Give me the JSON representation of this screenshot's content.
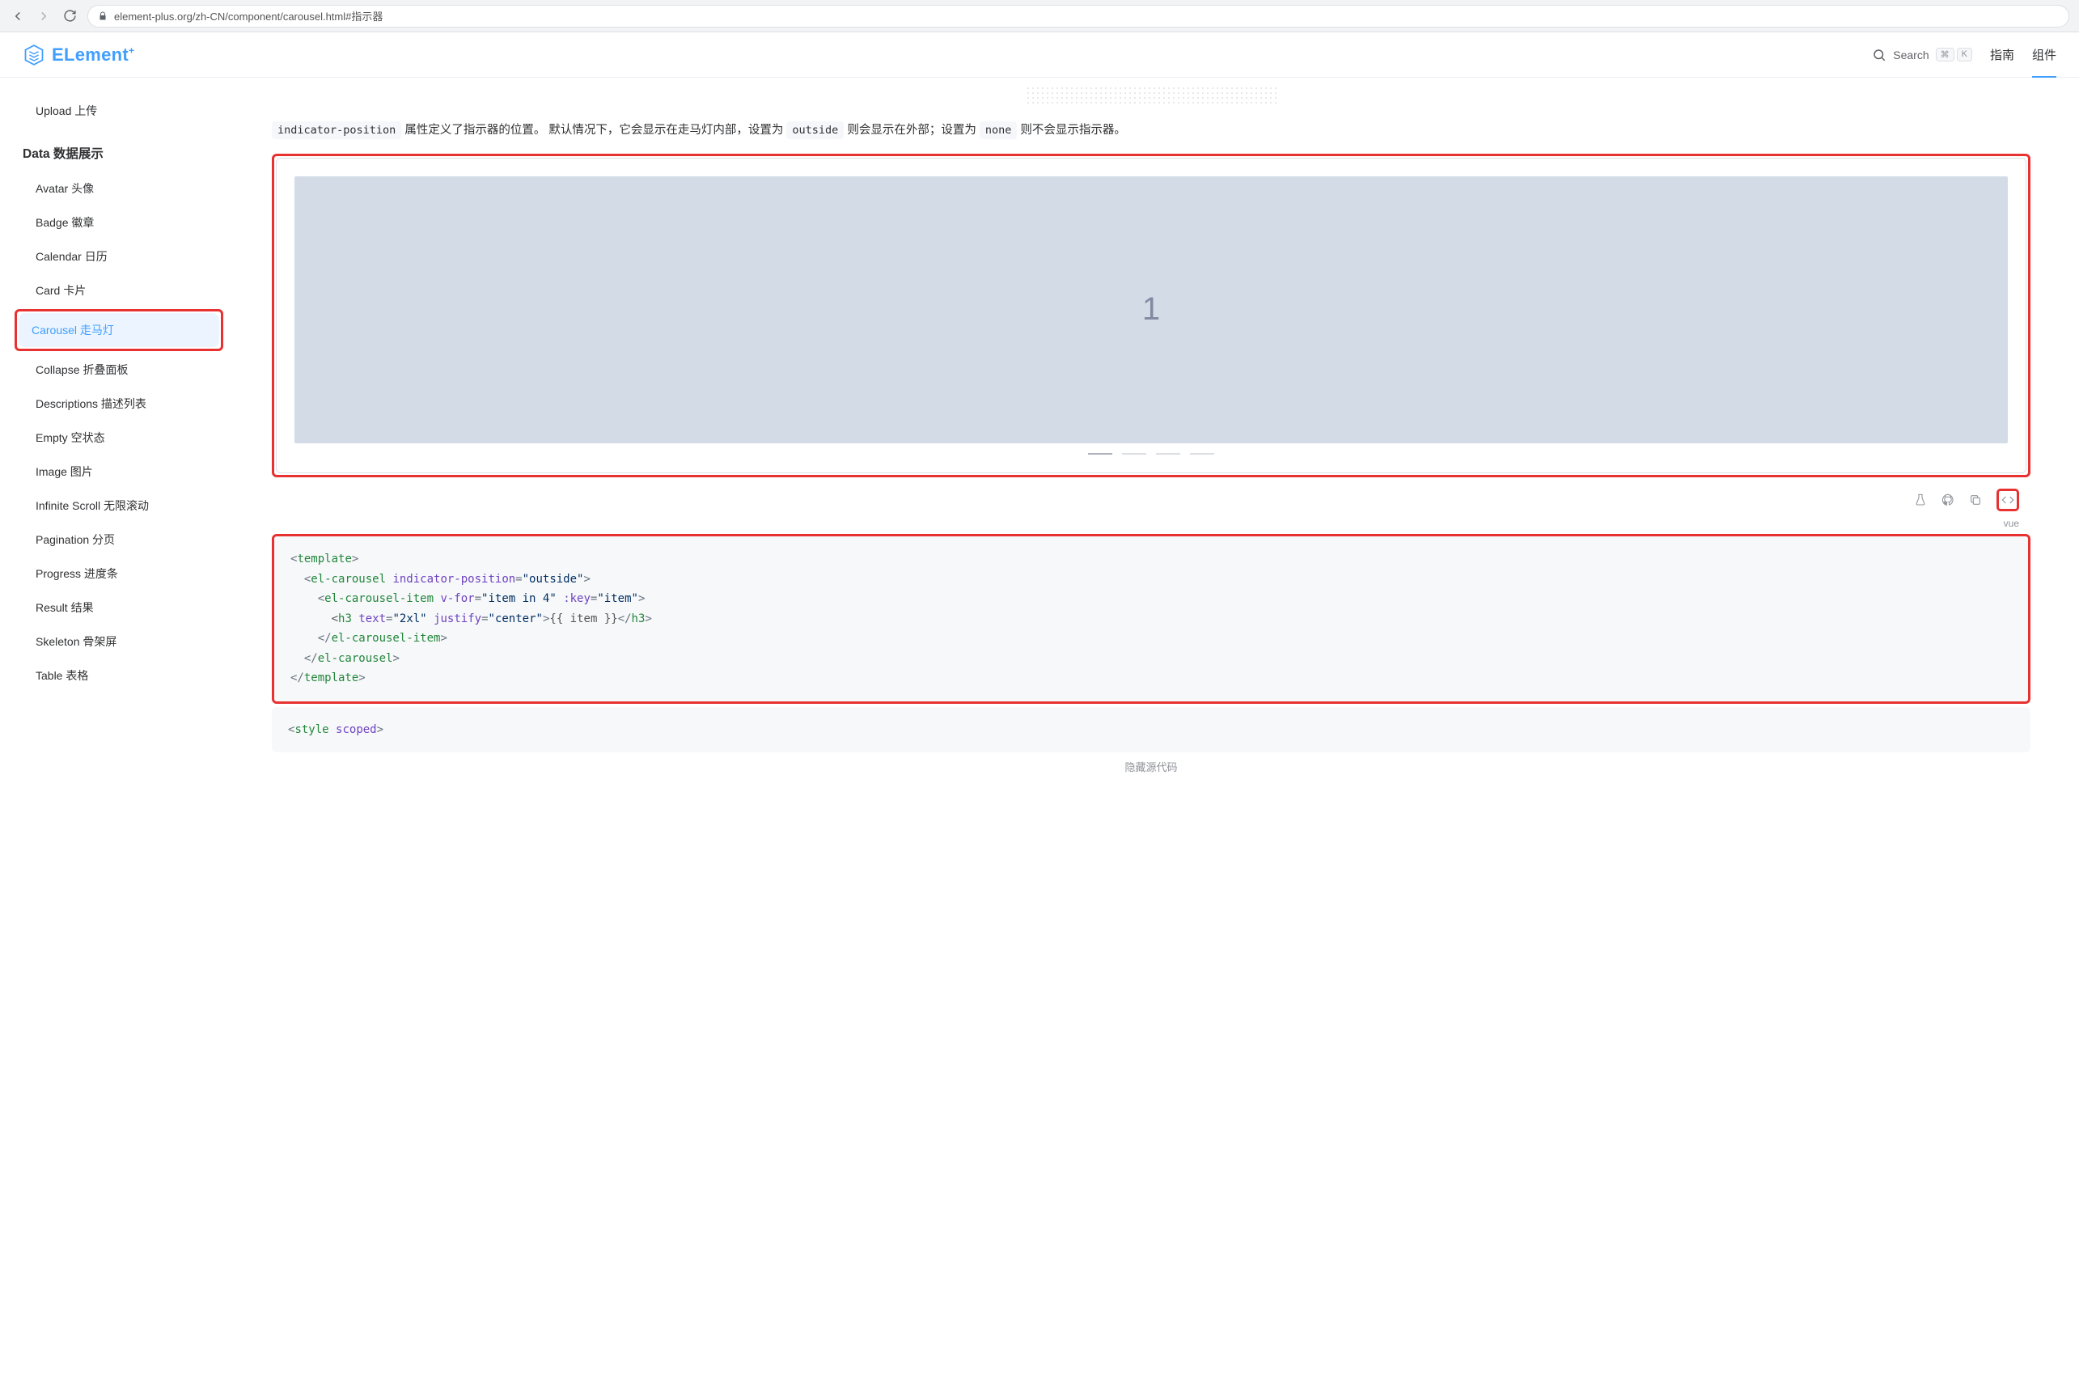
{
  "browser": {
    "url": "element-plus.org/zh-CN/component/carousel.html#指示器"
  },
  "header": {
    "logo_text": "ELement",
    "logo_sup": "+",
    "search_label": "Search",
    "shortcut1": "⌘",
    "shortcut2": "K",
    "nav": {
      "guide": "指南",
      "component": "组件"
    }
  },
  "sidebar": {
    "upload": "Upload 上传",
    "section_data": "Data 数据展示",
    "items": {
      "avatar": "Avatar 头像",
      "badge": "Badge 徽章",
      "calendar": "Calendar 日历",
      "card": "Card 卡片",
      "carousel": "Carousel 走马灯",
      "collapse": "Collapse 折叠面板",
      "descriptions": "Descriptions 描述列表",
      "empty": "Empty 空状态",
      "image": "Image 图片",
      "infinite": "Infinite Scroll 无限滚动",
      "pagination": "Pagination 分页",
      "progress": "Progress 进度条",
      "result": "Result 结果",
      "skeleton": "Skeleton 骨架屏",
      "table": "Table 表格"
    }
  },
  "desc": {
    "code_indicator": "indicator-position",
    "part1": " 属性定义了指示器的位置。 默认情况下，它会显示在走马灯内部，设置为 ",
    "code_outside": "outside",
    "part2": " 则会显示在外部；设置为 ",
    "code_none": "none",
    "part3": " 则不会显示指示器。"
  },
  "demo": {
    "slide_num": "1",
    "lang": "vue"
  },
  "code": {
    "l1_open": "<",
    "l1_tag": "template",
    "l1_close": ">",
    "l2_open": "<",
    "l2_tag": "el-carousel",
    "l2_sp": " ",
    "l2_attr": "indicator-position",
    "l2_eq": "=",
    "l2_val": "\"outside\"",
    "l2_close": ">",
    "l3_open": "<",
    "l3_tag": "el-carousel-item",
    "l3_sp1": " ",
    "l3_attr1": "v-for",
    "l3_eq1": "=",
    "l3_val1": "\"item in 4\"",
    "l3_sp2": " ",
    "l3_attr2": ":key",
    "l3_eq2": "=",
    "l3_val2": "\"item\"",
    "l3_close": ">",
    "l4_open": "<",
    "l4_tag": "h3",
    "l4_sp1": " ",
    "l4_attr1": "text",
    "l4_eq1": "=",
    "l4_val1": "\"2xl\"",
    "l4_sp2": " ",
    "l4_attr2": "justify",
    "l4_eq2": "=",
    "l4_val2": "\"center\"",
    "l4_close": ">",
    "l4_inner": "{{ item }}",
    "l4_cls_open": "</",
    "l4_cls_tag": "h3",
    "l4_cls_close": ">",
    "l5_open": "</",
    "l5_tag": "el-carousel-item",
    "l5_close": ">",
    "l6_open": "</",
    "l6_tag": "el-carousel",
    "l6_close": ">",
    "l7_open": "</",
    "l7_tag": "template",
    "l7_close": ">",
    "style_open": "<",
    "style_tag": "style",
    "style_sp": " ",
    "style_attr": "scoped",
    "style_close": ">"
  },
  "hide_src": "隐藏源代码"
}
